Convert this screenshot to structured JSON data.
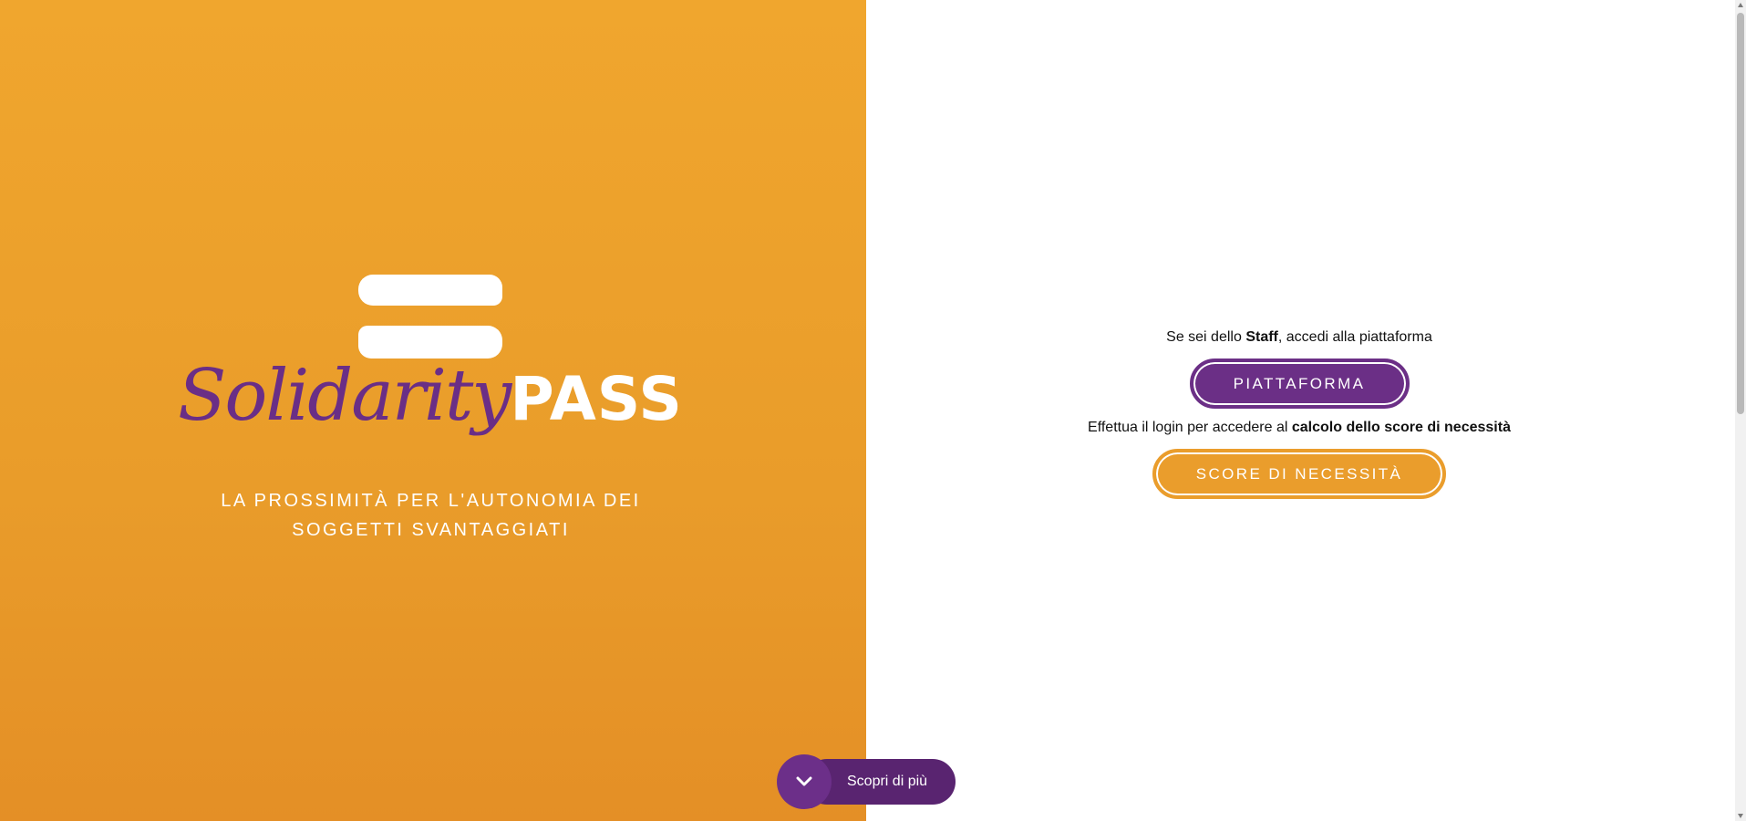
{
  "brand": {
    "logo_script": "Solidarity",
    "logo_bold": "PASS",
    "tagline_line1": "LA PROSSIMITÀ PER L'AUTONOMIA DEI",
    "tagline_line2": "SOGGETTI SVANTAGGIATI"
  },
  "staff_section": {
    "text_before": "Se sei dello ",
    "text_bold": "Staff",
    "text_after": ", accedi alla piattaforma",
    "button_label": "PIATTAFORMA"
  },
  "score_section": {
    "text_before": "Effettua il login per accedere al ",
    "text_bold": "calcolo dello score di necessità",
    "button_label": "SCORE DI NECESSITÀ"
  },
  "discover": {
    "label": "Scopri di più",
    "icon": "chevron-down-icon"
  },
  "colors": {
    "orange": "#f0a62e",
    "purple": "#6b2f86",
    "dark_purple": "#592470",
    "white": "#ffffff"
  }
}
